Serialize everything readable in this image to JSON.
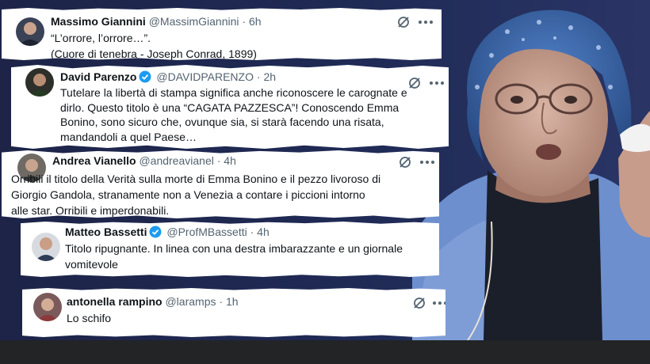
{
  "tweets": [
    {
      "name": "Massimo Giannini",
      "handle": "@MassimGiannini",
      "sep": "·",
      "time": "6h",
      "verified": false,
      "lines": [
        "“L’orrore, l’orrore…”.",
        "(Cuore di tenebra - Joseph Conrad, 1899)"
      ]
    },
    {
      "name": "David Parenzo",
      "handle": "@DAVIDPARENZO",
      "sep": "·",
      "time": "2h",
      "verified": true,
      "lines": [
        "Tutelare la libertà di stampa significa anche riconoscere le carognate e",
        "dirlo. Questo titolo è una “CAGATA PAZZESCA”! Conoscendo Emma",
        "Bonino, sono sicuro che, ovunque sia, si starà facendo una risata,",
        "mandandoli a quel Paese…"
      ]
    },
    {
      "name": "Andrea Vianello",
      "handle": "@andreavianel",
      "sep": "·",
      "time": "4h",
      "verified": false,
      "lines": [
        "Orribili il titolo della Verità sulla morte di Emma Bonino e il pezzo livoroso di",
        "Giorgio Gandola, stranamente non a Venezia a contare i piccioni intorno",
        "alle star. Orribili e  imperdonabili."
      ]
    },
    {
      "name": "Matteo Bassetti",
      "handle": "@ProfMBassetti",
      "sep": "·",
      "time": "4h",
      "verified": true,
      "lines": [
        "Titolo ripugnante. In linea con una destra imbarazzante e un giornale",
        "vomitevole"
      ]
    },
    {
      "name": "antonella rampino",
      "handle": "@laramps",
      "sep": "·",
      "time": "1h",
      "verified": false,
      "lines": [
        "Lo schifo"
      ]
    }
  ],
  "colors": {
    "verified": "#1d9bf0",
    "handle": "#536471",
    "text": "#0f1419",
    "background": "#1d2448"
  }
}
